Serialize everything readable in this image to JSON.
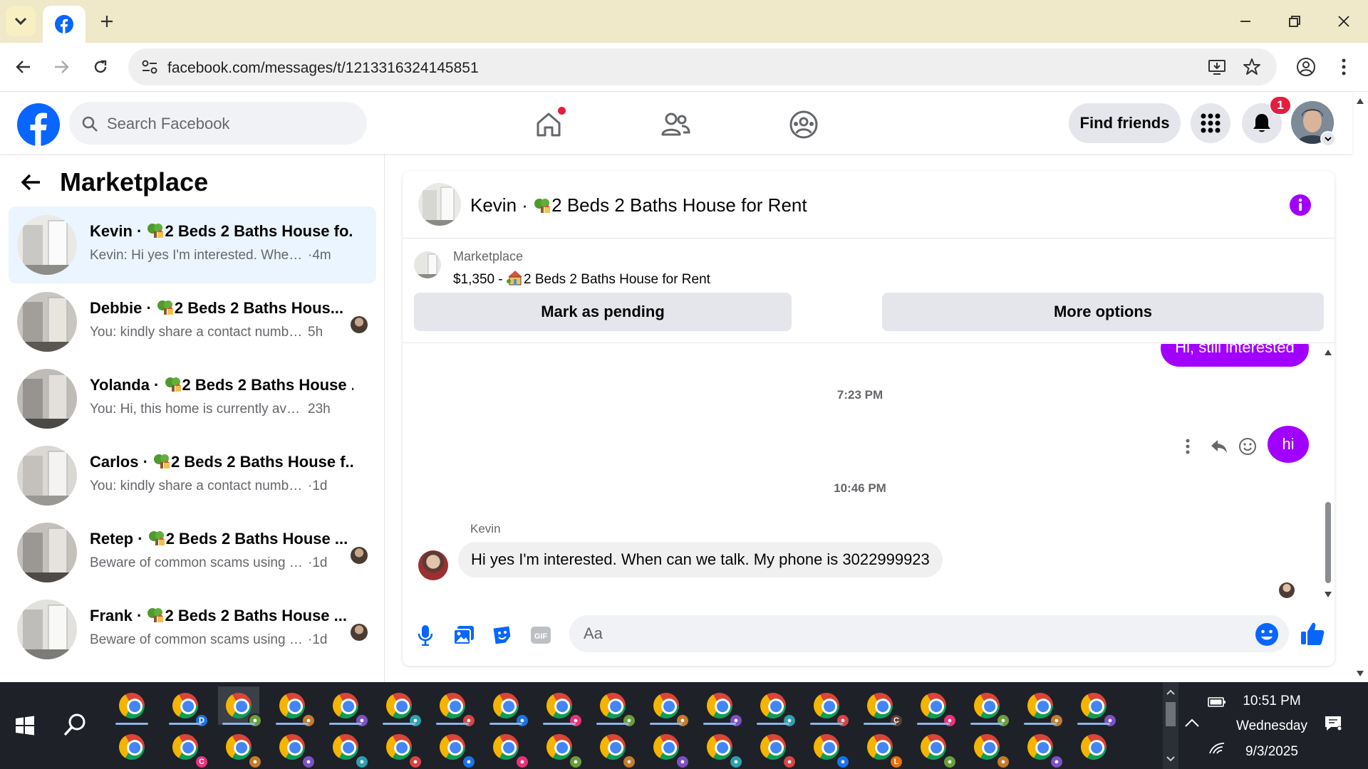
{
  "browser": {
    "url": "facebook.com/messages/t/1213316324145851",
    "new_tab": "+"
  },
  "fb": {
    "search_placeholder": "Search Facebook",
    "find_friends": "Find friends",
    "notif_count": "1",
    "brand_color": "#0866ff",
    "accent_color": "#a100ff"
  },
  "sidebar": {
    "title": "Marketplace",
    "conversations": [
      {
        "name": "Kevin · 2 Beds 2 Baths House fo...",
        "preview": "Kevin: Hi yes I'm interested. When ca...",
        "time": "·4m",
        "active": true
      },
      {
        "name": "Debbie · 2 Beds 2 Baths Hous...",
        "preview": "You: kindly share a contact number...",
        "time": "5h"
      },
      {
        "name": "Yolanda · 2 Beds 2 Baths House ...",
        "preview": "You: Hi, this home is currently availa...",
        "time": "23h"
      },
      {
        "name": "Carlos · 2 Beds 2 Baths House f...",
        "preview": "You: kindly share a contact number so...",
        "time": "·1d"
      },
      {
        "name": "Retep · 2 Beds 2 Baths House ...",
        "preview": "Beware of common scams using p...",
        "time": "·1d"
      },
      {
        "name": "Frank · 2 Beds 2 Baths House ...",
        "preview": "Beware of common scams using p...",
        "time": "·1d"
      }
    ]
  },
  "chat": {
    "title_name": "Kevin · ",
    "title_listing": "2 Beds 2 Baths House for Rent",
    "listing_label": "Marketplace",
    "listing_price": "$1,350 - ",
    "listing_title": "2 Beds 2 Baths House for Rent",
    "mark_pending": "Mark as pending",
    "more_options": "More options",
    "messages": [
      {
        "from": "me",
        "text": "Hi, still interested"
      },
      {
        "timestamp": "7:23 PM"
      },
      {
        "from": "me",
        "text": "hi"
      },
      {
        "timestamp": "10:46 PM"
      },
      {
        "from": "Kevin",
        "text": "Hi yes I'm interested. When can we talk. My phone is 3022999923"
      }
    ],
    "sender_name": "Kevin",
    "input_placeholder": "Aa"
  },
  "taskbar": {
    "time": "10:51 PM",
    "day": "Wednesday",
    "date": "9/3/2025",
    "profile_letters": [
      "D",
      "C",
      "C",
      "L"
    ]
  }
}
